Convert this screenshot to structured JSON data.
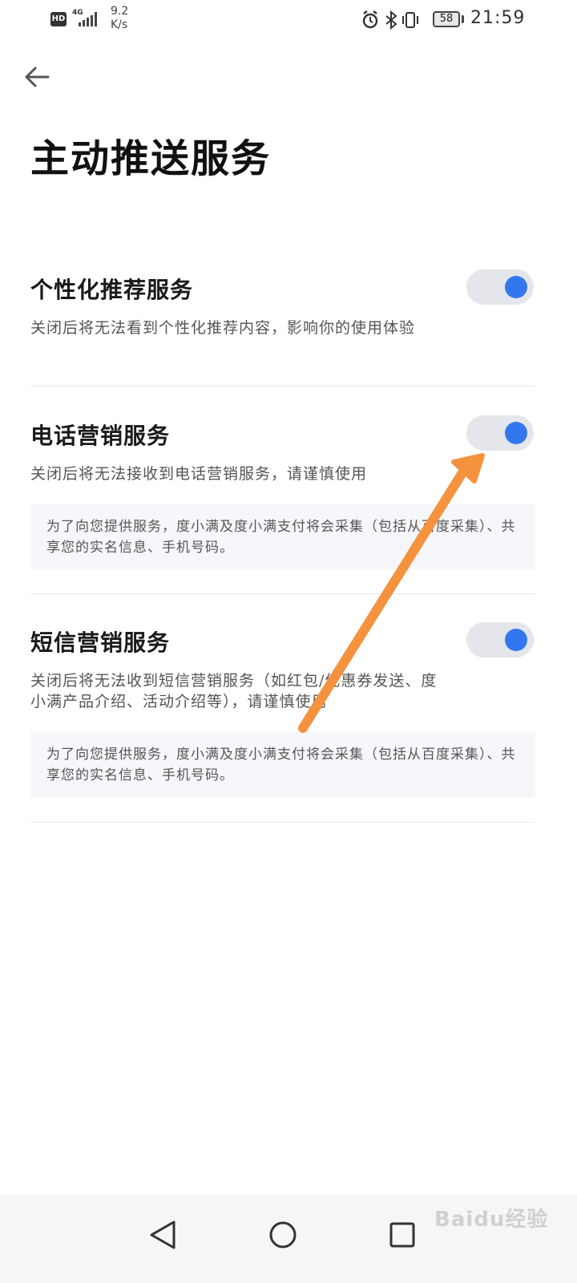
{
  "status_bar": {
    "hd": "HD",
    "network": "4G",
    "speed_value": "9.2",
    "speed_unit": "K/s",
    "battery": "58",
    "time": "21:59",
    "icons": [
      "alarm-icon",
      "bluetooth-icon",
      "vibrate-icon"
    ]
  },
  "header": {
    "back_icon": "back-arrow-icon",
    "title": "主动推送服务"
  },
  "sections": [
    {
      "title": "个性化推荐服务",
      "desc": "关闭后将无法看到个性化推荐内容，影响你的使用体验",
      "toggle_on": true
    },
    {
      "title": "电话营销服务",
      "desc": "关闭后将无法接收到电话营销服务，请谨慎使用",
      "notice": "为了向您提供服务，度小满及度小满支付将会采集（包括从百度采集）、共享您的实名信息、手机号码。",
      "toggle_on": true
    },
    {
      "title": "短信营销服务",
      "desc": "关闭后将无法收到短信营销服务（如红包/优惠券发送、度小满产品介绍、活动介绍等），请谨慎使用",
      "notice": "为了向您提供服务，度小满及度小满支付将会采集（包括从百度采集）、共享您的实名信息、手机号码。",
      "toggle_on": true
    }
  ],
  "colors": {
    "toggle_track": "#e4e6ec",
    "toggle_knob": "#3377ee",
    "annotation_arrow": "#f5923e"
  },
  "nav_bar": {
    "icons": [
      "back-triangle-icon",
      "home-circle-icon",
      "recents-square-icon"
    ]
  },
  "watermark": "Baidu经验"
}
